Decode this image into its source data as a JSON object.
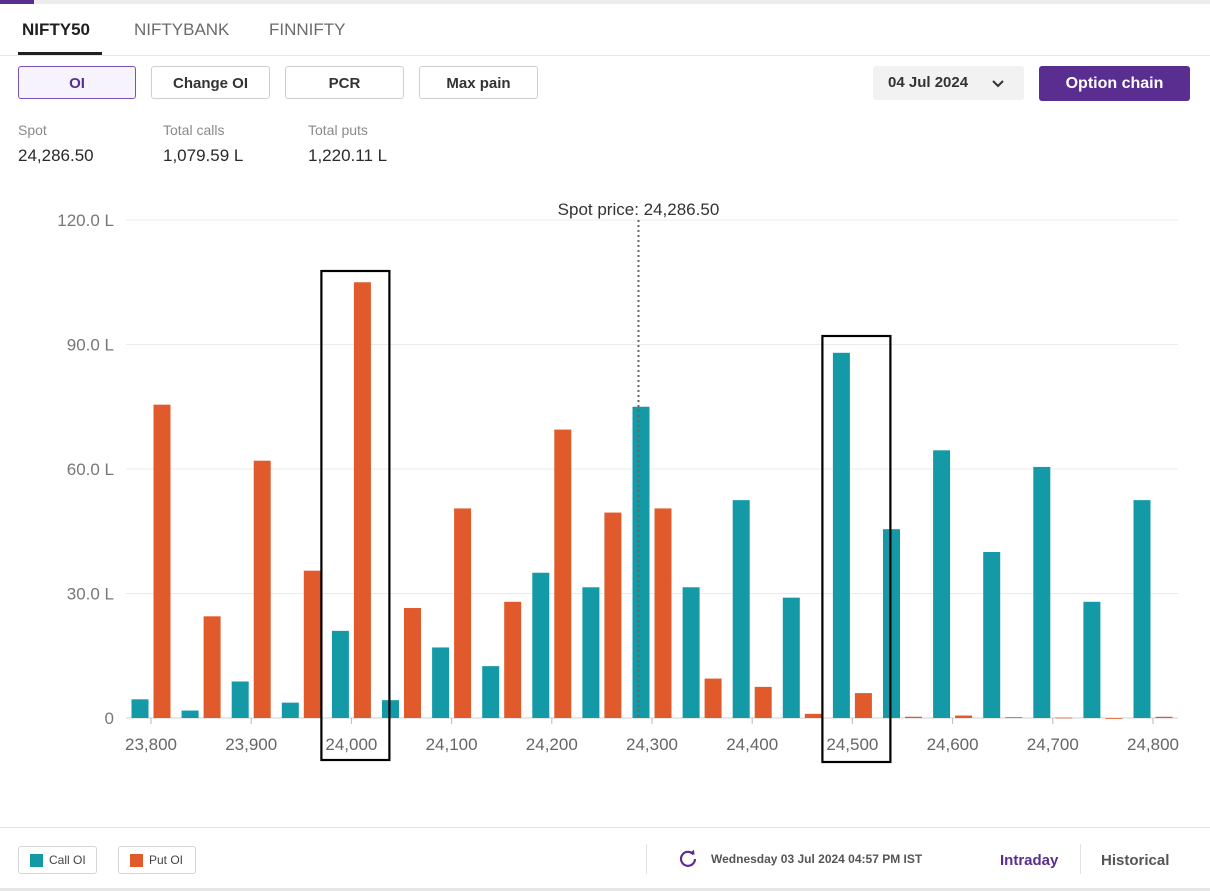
{
  "tabs": [
    "NIFTY50",
    "NIFTYBANK",
    "FINNIFTY"
  ],
  "buttons": {
    "oi": "OI",
    "change_oi": "Change OI",
    "pcr": "PCR",
    "max_pain": "Max pain",
    "option_chain": "Option chain"
  },
  "date_select": {
    "value": "04 Jul 2024",
    "icon": "chevron-down-icon"
  },
  "stats": {
    "spot_label": "Spot",
    "spot_value": "24,286.50",
    "calls_label": "Total calls",
    "calls_value": "1,079.59 L",
    "puts_label": "Total puts",
    "puts_value": "1,220.11 L"
  },
  "chart_data": {
    "type": "bar",
    "categories": [
      23800,
      23850,
      23900,
      23950,
      24000,
      24050,
      24100,
      24150,
      24200,
      24250,
      24300,
      24350,
      24400,
      24450,
      24500,
      24550,
      24600,
      24650,
      24700,
      24750,
      24800
    ],
    "series": [
      {
        "name": "Call OI",
        "color": "#149aa7",
        "values": [
          4.5,
          1.8,
          8.8,
          3.7,
          21.0,
          4.3,
          17.0,
          12.5,
          35.0,
          31.5,
          75.0,
          31.5,
          52.5,
          29.0,
          88.0,
          45.5,
          64.5,
          40.0,
          60.5,
          28.0,
          52.5
        ]
      },
      {
        "name": "Put OI",
        "color": "#e05a2b",
        "values": [
          75.5,
          24.5,
          62.0,
          35.5,
          105.0,
          26.5,
          50.5,
          28.0,
          69.5,
          49.5,
          50.5,
          9.5,
          7.5,
          1.0,
          6.0,
          0.3,
          0.6,
          0.2,
          0.1,
          0.0,
          0.3
        ]
      }
    ],
    "xticks": [
      "23,800",
      "23,900",
      "24,000",
      "24,100",
      "24,200",
      "24,300",
      "24,400",
      "24,500",
      "24,600",
      "24,700",
      "24,800"
    ],
    "yticks": [
      "0",
      "30.0 L",
      "60.0 L",
      "90.0 L",
      "120.0 L"
    ],
    "ylim": [
      0,
      120
    ],
    "spot": 24286.5,
    "spot_label": "Spot price: 24,286.50",
    "highlight_strikes": [
      24000,
      24500
    ],
    "grid": true
  },
  "legend": [
    "Call OI",
    "Put OI"
  ],
  "footer": {
    "refresh_icon": "refresh-icon",
    "updated": "Wednesday 03 Jul 2024 04:57 PM IST",
    "intraday": "Intraday",
    "historical": "Historical"
  },
  "colors": {
    "accent": "#5a2d91",
    "call": "#149aa7",
    "put": "#e05a2b"
  }
}
